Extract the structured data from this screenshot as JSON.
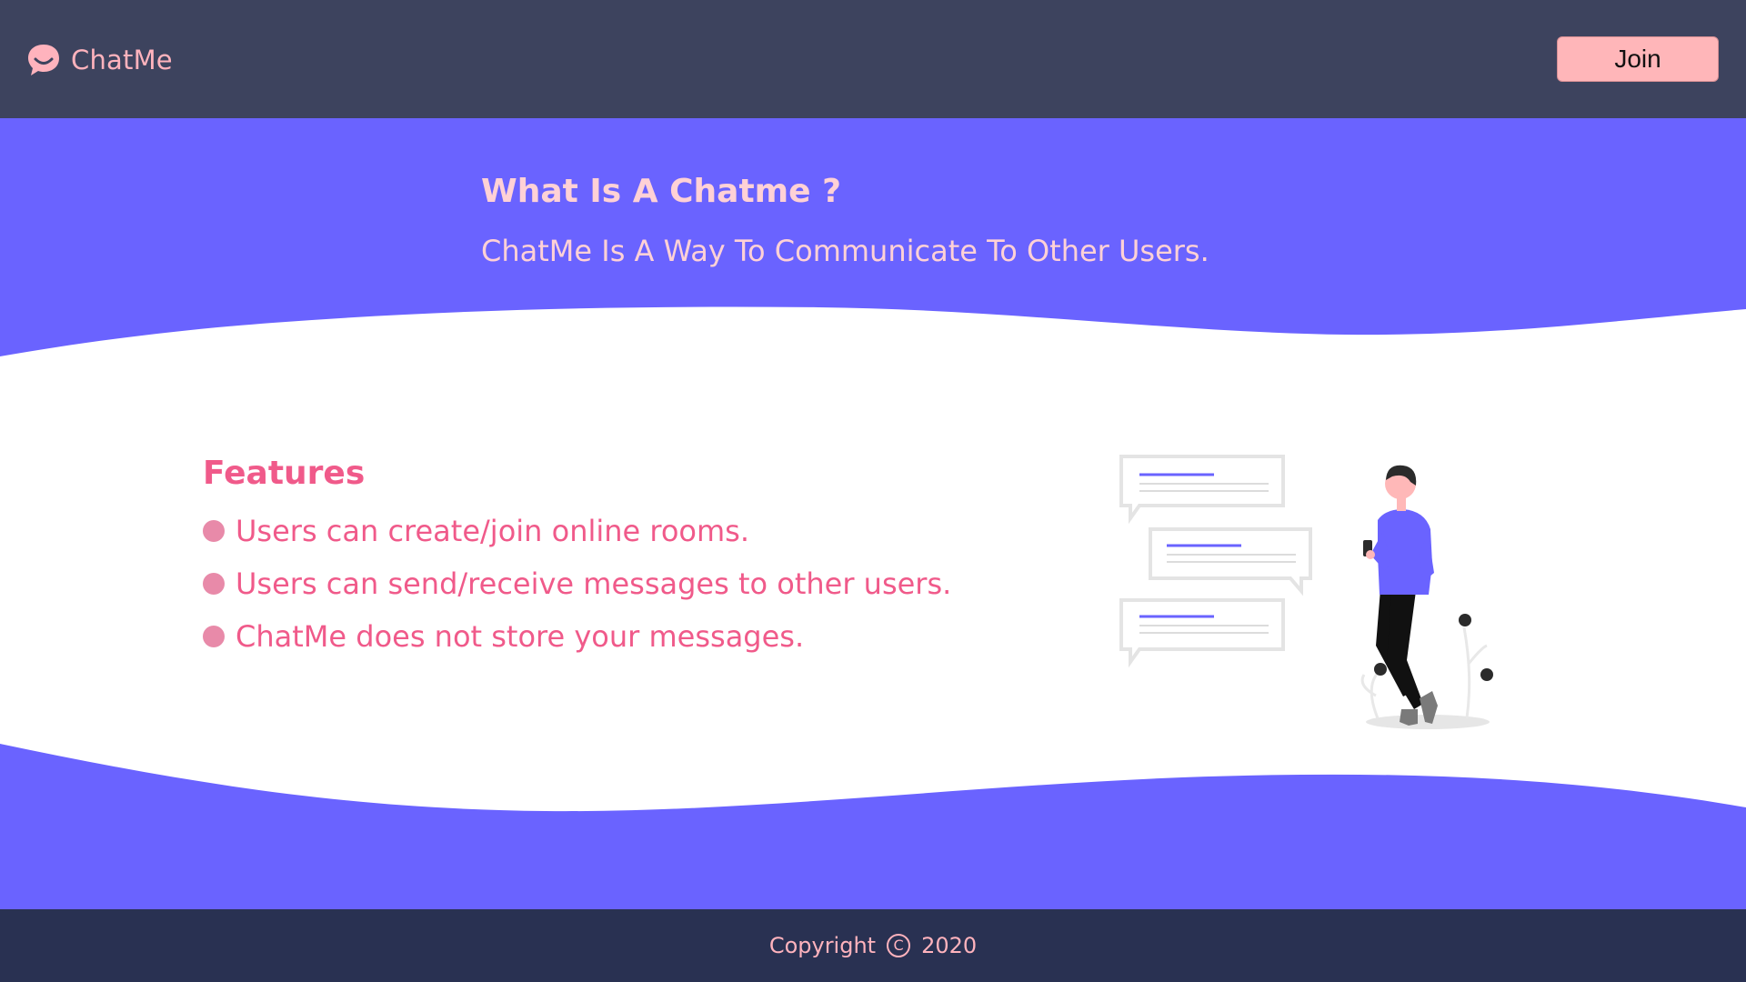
{
  "navbar": {
    "brand": "ChatMe",
    "brand_icon": "chat-bubble-smile-icon",
    "join_label": "Join"
  },
  "hero": {
    "title": "What Is A Chatme ?",
    "subtitle": "ChatMe Is A Way To Communicate To Other Users."
  },
  "features": {
    "title": "Features",
    "items": [
      "Users can create/join online rooms.",
      "Users can send/receive messages to other users.",
      "ChatMe does not store your messages."
    ]
  },
  "illustration": {
    "name": "person-texting-chat-bubbles-illustration"
  },
  "footer": {
    "copyright": "Copyright",
    "copyright_icon": "copyright-icon",
    "copyright_symbol": "C",
    "year": "2020"
  },
  "colors": {
    "navbar": "#3d435e",
    "accent_purple": "#6a63ff",
    "pink": "#ffb6b9",
    "feature_text": "#f05a8a",
    "footer": "#293152"
  }
}
